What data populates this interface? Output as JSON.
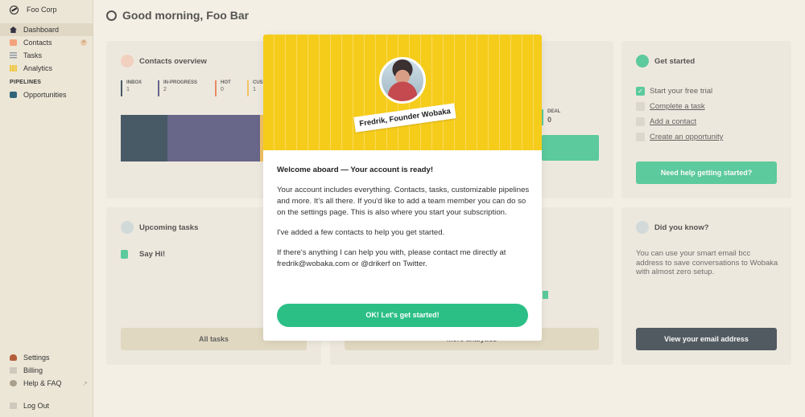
{
  "sidebar": {
    "company": "Foo Corp",
    "items": [
      {
        "label": "Dashboard",
        "icon": "home-icon"
      },
      {
        "label": "Contacts",
        "icon": "contacts-icon"
      },
      {
        "label": "Tasks",
        "icon": "tasks-icon"
      },
      {
        "label": "Analytics",
        "icon": "analytics-icon"
      }
    ],
    "pipelines_label": "PIPELINES",
    "pipelines": [
      {
        "label": "Opportunities",
        "icon": "pipeline-icon"
      }
    ],
    "bottom": [
      {
        "label": "Settings",
        "icon": "settings-icon"
      },
      {
        "label": "Billing",
        "icon": "billing-icon"
      },
      {
        "label": "Help & FAQ",
        "icon": "help-icon"
      },
      {
        "label": "Log Out",
        "icon": "logout-icon"
      }
    ],
    "external_link_icon": "external-link-icon",
    "add_icon": "plus-icon"
  },
  "header": {
    "title": "Good morning, Foo Bar",
    "icon": "sun-icon"
  },
  "contacts_overview": {
    "title": "Contacts overview",
    "stages": [
      {
        "label": "INBOX",
        "count": "1",
        "color": "#0f2a3d"
      },
      {
        "label": "IN-PROGRESS",
        "count": "2",
        "color": "#3b3a6b"
      },
      {
        "label": "HOT",
        "count": "0",
        "color": "#e36b3b"
      },
      {
        "label": "CUS",
        "count": "1",
        "color": "#f2b63a"
      }
    ],
    "deal_label": "DEAL",
    "deal_count": "0"
  },
  "get_started": {
    "title": "Get started",
    "items": [
      {
        "label": "Start your free trial",
        "checked": true
      },
      {
        "label": "Complete a task",
        "checked": false
      },
      {
        "label": "Add a contact",
        "checked": false
      },
      {
        "label": "Create an opportunity",
        "checked": false
      }
    ],
    "button": "Need help getting started?"
  },
  "upcoming_tasks": {
    "title": "Upcoming tasks",
    "item": "Say Hi!",
    "button": "All tasks"
  },
  "analytics": {
    "button": "More analytics"
  },
  "did_you_know": {
    "title": "Did you know?",
    "text": "You can use your smart email bcc address to save conversations to Wobaka with almost zero setup.",
    "button": "View your email address"
  },
  "modal": {
    "name_tag": "Fredrik, Founder Wobaka",
    "heading": "Welcome aboard — Your account is ready!",
    "p1": "Your account includes everything. Contacts, tasks, customizable pipelines and more. It's all there. If you'd like to add a team member you can do so on the settings page. This is also where you start your subscription.",
    "p2": "I've added a few contacts to help you get started.",
    "p3": "If there's anything I can help you with, please contact me directly at fredrik@wobaka.com or @drikerf on Twitter.",
    "cta": "OK! Let's get started!",
    "colors": {
      "hero": "#f6cc1b",
      "cta": "#2bbf86"
    }
  }
}
